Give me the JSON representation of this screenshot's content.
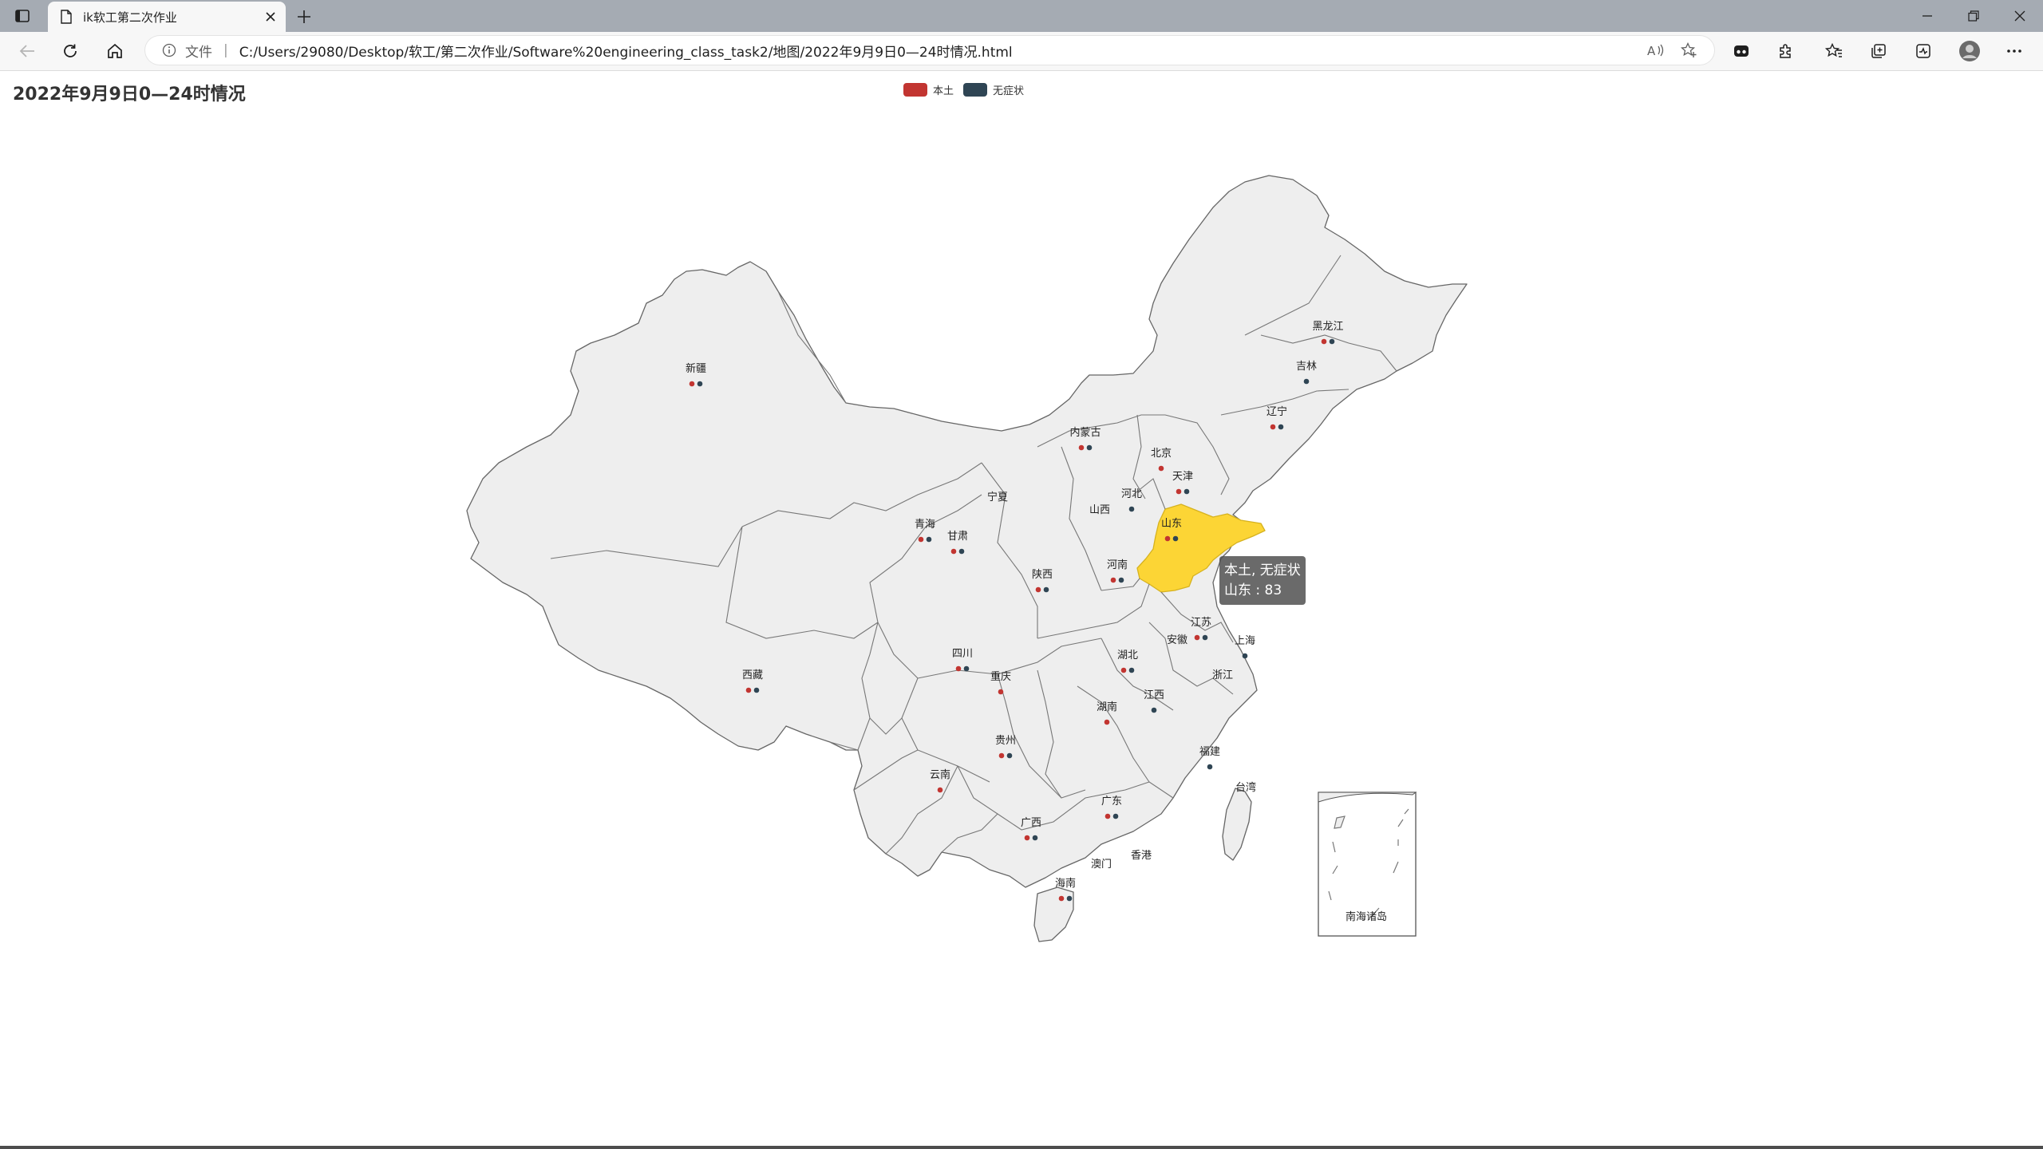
{
  "browser": {
    "tab_title": "ik软工第二次作业",
    "address_scheme": "文件",
    "address_url": "C:/Users/29080/Desktop/软工/第二次作业/Software%20engineering_class_task2/地图/2022年9月9日0—24时情况.html"
  },
  "page": {
    "title": "2022年9月9日0—24时情况"
  },
  "legend": {
    "items": [
      {
        "label": "本土",
        "color": "#c23531"
      },
      {
        "label": "无症状",
        "color": "#2f4554"
      }
    ]
  },
  "colors": {
    "province_fill": "#eeeeee",
    "province_stroke": "#555555",
    "highlight_fill": "#fcd535",
    "tab_strip": "#a5abb3",
    "toolbar": "#f7f7f7"
  },
  "map": {
    "provinces": [
      {
        "name": "黑龙江",
        "series": [
          "本土",
          "无症状"
        ]
      },
      {
        "name": "吉林",
        "series": [
          "无症状"
        ]
      },
      {
        "name": "辽宁",
        "series": [
          "本土",
          "无症状"
        ]
      },
      {
        "name": "内蒙古",
        "series": [
          "本土",
          "无症状"
        ]
      },
      {
        "name": "北京",
        "series": [
          "本土"
        ]
      },
      {
        "name": "天津",
        "series": [
          "本土",
          "无症状"
        ]
      },
      {
        "name": "河北",
        "series": [
          "无症状"
        ]
      },
      {
        "name": "山西",
        "series": []
      },
      {
        "name": "山东",
        "series": [
          "本土",
          "无症状"
        ],
        "highlighted": true
      },
      {
        "name": "新疆",
        "series": [
          "本土",
          "无症状"
        ]
      },
      {
        "name": "宁夏",
        "series": []
      },
      {
        "name": "青海",
        "series": [
          "本土",
          "无症状"
        ]
      },
      {
        "name": "甘肃",
        "series": [
          "本土",
          "无症状"
        ]
      },
      {
        "name": "陕西",
        "series": [
          "本土",
          "无症状"
        ]
      },
      {
        "name": "河南",
        "series": [
          "本土",
          "无症状"
        ]
      },
      {
        "name": "西藏",
        "series": [
          "本土",
          "无症状"
        ]
      },
      {
        "name": "四川",
        "series": [
          "本土",
          "无症状"
        ]
      },
      {
        "name": "重庆",
        "series": [
          "本土"
        ]
      },
      {
        "name": "湖北",
        "series": [
          "本土",
          "无症状"
        ]
      },
      {
        "name": "江苏",
        "series": [
          "本土",
          "无症状"
        ]
      },
      {
        "name": "安徽",
        "series": []
      },
      {
        "name": "上海",
        "series": [
          "无症状"
        ]
      },
      {
        "name": "浙江",
        "series": []
      },
      {
        "name": "湖南",
        "series": [
          "本土"
        ]
      },
      {
        "name": "江西",
        "series": [
          "无症状"
        ]
      },
      {
        "name": "贵州",
        "series": [
          "本土",
          "无症状"
        ]
      },
      {
        "name": "云南",
        "series": [
          "本土"
        ]
      },
      {
        "name": "福建",
        "series": [
          "无症状"
        ]
      },
      {
        "name": "台湾",
        "series": []
      },
      {
        "name": "广东",
        "series": [
          "本土",
          "无症状"
        ]
      },
      {
        "name": "广西",
        "series": [
          "本土",
          "无症状"
        ]
      },
      {
        "name": "香港",
        "series": []
      },
      {
        "name": "澳门",
        "series": []
      },
      {
        "name": "海南",
        "series": [
          "本土",
          "无症状"
        ]
      }
    ],
    "inset_label": "南海诸岛"
  },
  "tooltip": {
    "series": "本土, 无症状",
    "line": "山东 : 83"
  }
}
